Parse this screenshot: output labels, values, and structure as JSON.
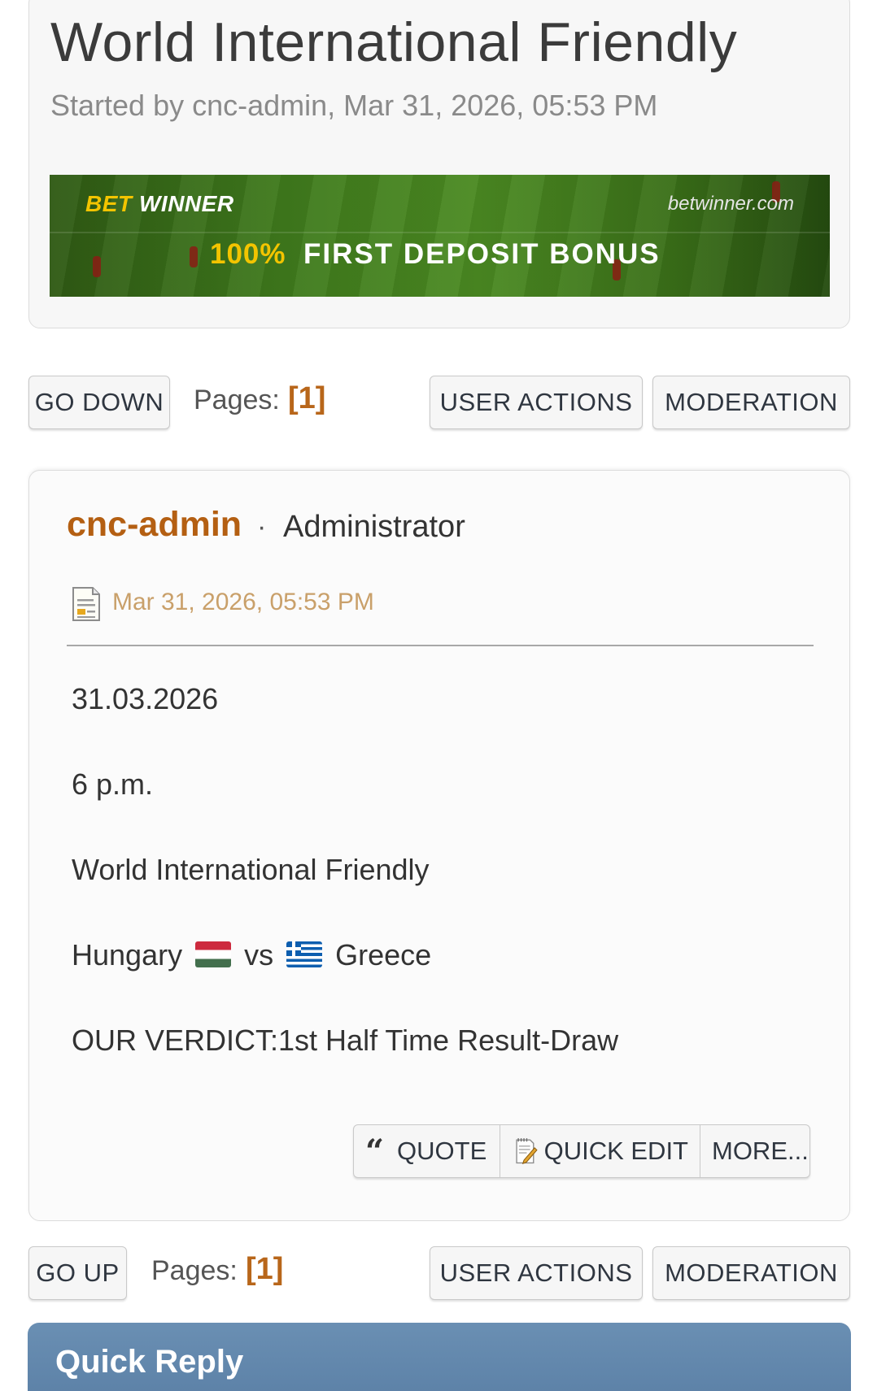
{
  "topic": {
    "title": "World International Friendly",
    "meta": "Started by cnc-admin, Mar 31, 2026, 05:53 PM"
  },
  "banner": {
    "brand_bet": "BET",
    "brand_winner": "WINNER",
    "url": "betwinner.com",
    "bonus_percent": "100%",
    "bonus_text": "FIRST DEPOSIT BONUS"
  },
  "top_bar": {
    "go_label": "GO DOWN",
    "pages_label": "Pages:",
    "current_page": "[1]",
    "user_actions_label": "USER ACTIONS",
    "moderation_label": "MODERATION"
  },
  "post": {
    "author": "cnc-admin",
    "separator": "·",
    "role": "Administrator",
    "date": "Mar 31, 2026, 05:53 PM",
    "lines": {
      "date_line": "31.03.2026",
      "time_line": "6 p.m.",
      "competition": "World International Friendly",
      "home_team": "Hungary",
      "vs": "vs",
      "away_team": "Greece",
      "verdict": "OUR VERDICT:1st Half Time Result-Draw"
    },
    "actions": {
      "quote_label": "QUOTE",
      "quick_edit_label": "QUICK EDIT",
      "more_label": "MORE..."
    }
  },
  "bottom_bar": {
    "go_label": "GO UP",
    "pages_label": "Pages:",
    "current_page": "[1]",
    "user_actions_label": "USER ACTIONS",
    "moderation_label": "MODERATION"
  },
  "quick_reply": {
    "title": "Quick Reply"
  },
  "icons": {
    "post_icon": "document-icon",
    "quote_icon": "quote-icon",
    "edit_icon": "edit-note-icon",
    "flag_home": "hungary-flag-icon",
    "flag_away": "greece-flag-icon"
  },
  "colors": {
    "accent": "#b45f12",
    "page_number": "#b8661a",
    "date_text": "#c9a06a",
    "quick_reply_bg": "#6a8fb3"
  }
}
